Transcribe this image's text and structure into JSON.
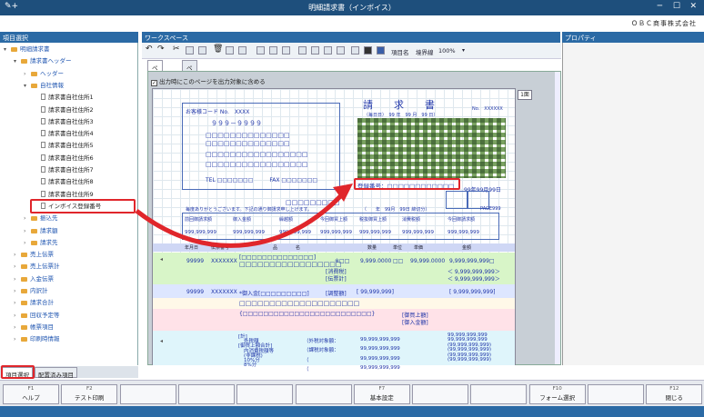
{
  "window": {
    "title": "明細請求書（インボイス）",
    "app_icon": "✎+",
    "minimize": "─",
    "maximize": "☐",
    "close": "✕"
  },
  "company": "ＯＢＣ商事株式会社",
  "panels": {
    "items": "項目選択",
    "workspace": "ワークスペース",
    "properties": "プロパティ"
  },
  "tree": [
    {
      "label": "明細請求書",
      "level": 0,
      "exp": "▾",
      "icon": "folder",
      "blue": true
    },
    {
      "label": "請求書ヘッダー",
      "level": 1,
      "exp": "▾",
      "icon": "folder",
      "blue": true
    },
    {
      "label": "ヘッダー",
      "level": 2,
      "exp": "›",
      "icon": "folder",
      "blue": true
    },
    {
      "label": "自社情報",
      "level": 2,
      "exp": "▾",
      "icon": "folder",
      "blue": true
    },
    {
      "label": "請求書自社住所1",
      "level": 3,
      "exp": "",
      "icon": "doc",
      "blue": false
    },
    {
      "label": "請求書自社住所2",
      "level": 3,
      "exp": "",
      "icon": "doc",
      "blue": false
    },
    {
      "label": "請求書自社住所3",
      "level": 3,
      "exp": "",
      "icon": "doc",
      "blue": false
    },
    {
      "label": "請求書自社住所4",
      "level": 3,
      "exp": "",
      "icon": "doc",
      "blue": false
    },
    {
      "label": "請求書自社住所5",
      "level": 3,
      "exp": "",
      "icon": "doc",
      "blue": false
    },
    {
      "label": "請求書自社住所6",
      "level": 3,
      "exp": "",
      "icon": "doc",
      "blue": false
    },
    {
      "label": "請求書自社住所7",
      "level": 3,
      "exp": "",
      "icon": "doc",
      "blue": false
    },
    {
      "label": "請求書自社住所8",
      "level": 3,
      "exp": "",
      "icon": "doc",
      "blue": false
    },
    {
      "label": "請求書自社住所9",
      "level": 3,
      "exp": "",
      "icon": "doc",
      "blue": false
    },
    {
      "label": "インボイス登録番号",
      "level": 3,
      "exp": "",
      "icon": "doc",
      "blue": false
    },
    {
      "label": "振込先",
      "level": 2,
      "exp": "›",
      "icon": "folder",
      "blue": true
    },
    {
      "label": "請求額",
      "level": 2,
      "exp": "›",
      "icon": "folder",
      "blue": true
    },
    {
      "label": "請求先",
      "level": 2,
      "exp": "›",
      "icon": "folder",
      "blue": true
    },
    {
      "label": "売上伝票",
      "level": 1,
      "exp": "›",
      "icon": "folder",
      "blue": true
    },
    {
      "label": "売上伝票計",
      "level": 1,
      "exp": "›",
      "icon": "folder",
      "blue": true
    },
    {
      "label": "入金伝票",
      "level": 1,
      "exp": "›",
      "icon": "folder",
      "blue": true
    },
    {
      "label": "内訳計",
      "level": 1,
      "exp": "›",
      "icon": "folder",
      "blue": true
    },
    {
      "label": "請求合計",
      "level": 1,
      "exp": "›",
      "icon": "folder",
      "blue": true
    },
    {
      "label": "回収予定等",
      "level": 1,
      "exp": "›",
      "icon": "folder",
      "blue": true
    },
    {
      "label": "帳票項目",
      "level": 1,
      "exp": "›",
      "icon": "folder",
      "blue": true
    },
    {
      "label": "印刷時情報",
      "level": 1,
      "exp": "›",
      "icon": "folder",
      "blue": true
    }
  ],
  "bottom_tabs": [
    "項目選択",
    "配置済み項目"
  ],
  "toolbar": {
    "item_name": "項目名",
    "border": "境界線",
    "zoom": "100%",
    "zoom_arrow": "▾"
  },
  "page_tabs": [
    "ページ1",
    "ページ2"
  ],
  "checkbox": {
    "checked": true,
    "mark": "✓",
    "label": "出力時にこのページを出力対象に含める"
  },
  "one_button": "1面",
  "invoice": {
    "title": "請　求　書",
    "customer_code": "お客様コード No.　XXXX",
    "nines": "９９９－９９９９",
    "squares12": "□□□□□□□□□□□□□□",
    "squares8": "□□□□□□□□□□□□",
    "squares7": "□□□□□□□□□",
    "squares_name": "□□□□□□□□□□□□□□□□□",
    "tel": "TEL □□□□□□□　　　FAX □□□□□□□",
    "date_top": "（毎日日）　99 年　99 月　99 日）",
    "no": "No.　XXXXXX",
    "registration": "登録番号：□□□□□□□□□□□□",
    "ymd": "99年99月99日",
    "greeting": "毎度ありがとうございます。下記の通り御請求申し上げます。",
    "period": "（　　年　99月　99日 締切分）",
    "pageno": "PAGE999",
    "headers": [
      "前回御請求額",
      "御入金額",
      "繰越額",
      "今回御買上額",
      "税抜御買上額",
      "消費税額",
      "今回御請求額"
    ],
    "amounts": [
      "999,999,999",
      "999,999,999",
      "999,999,999",
      "999,999,999",
      "999,999,999",
      "999,999,999",
      "999,999,999"
    ],
    "detail_headers": [
      "年月日",
      "伝票番号",
      "品　　　　名",
      "数量",
      "単位",
      "単価",
      "金額"
    ],
    "row1": {
      "code": "99999",
      "slip": "XXXXXXX",
      "name": "[□□□□□□□□□□□□□□]",
      "mark": "※□□",
      "qty": "9,999.0000",
      "unit": "□□",
      "price": "99,999.0000",
      "amount": "9,999,999,999□"
    },
    "tax_label": "[消費税]",
    "tax_amt": "＜ 9,999,999,999＞",
    "slip_total": "[伝票計]",
    "slip_total_amt": "＜ 9,999,999,999＞",
    "row2": {
      "code": "99999",
      "slip": "XXXXXXX",
      "name": "*御入金[□□□□□□□□□]",
      "adj": "[調整額]",
      "adj_amt": "[ 99,999,999]",
      "amount": "[ 9,999,999,999]"
    },
    "row3_name": "□□□□□□□□□□□□□□□□□□□□",
    "row3b": "□□□□□□□□□□□□□□□□□",
    "row4_name": "{□□□□□□□□□□□□□□□□□□□□□□□□□}",
    "buy_label": "[御買上額]",
    "pay_label": "[御入金額]",
    "bottom_labels": [
      "[計]",
      "外税額",
      "[御買上額合計]",
      "内消費税額等",
      "(非課税)",
      "10%分",
      "8%分"
    ],
    "bottom_mid": [
      "（外税対象額：",
      "（課税対象額：",
      "（",
      "（"
    ],
    "bottom_vals": [
      "99,999,999,999",
      "99,999,999,999",
      "99,999,999,999",
      "99,999,999,999"
    ],
    "bottom_amts": [
      "99,999,999,999",
      "99,999,999,999",
      "(99,999,999,999)",
      "(99,999,999,999)",
      "(99,999,999,999)",
      "(99,999,999,999)"
    ]
  },
  "fkeys": [
    {
      "key": "F1",
      "label": "ヘルプ"
    },
    {
      "key": "F2",
      "label": "テスト印刷"
    },
    {
      "key": "",
      "label": ""
    },
    {
      "key": "",
      "label": ""
    },
    {
      "key": "",
      "label": ""
    },
    {
      "key": "",
      "label": ""
    },
    {
      "key": "F7",
      "label": "基本設定"
    },
    {
      "key": "",
      "label": ""
    },
    {
      "key": "",
      "label": ""
    },
    {
      "key": "F10",
      "label": "フォーム選択"
    },
    {
      "key": "",
      "label": ""
    },
    {
      "key": "F12",
      "label": "閉じる"
    }
  ],
  "colors": {
    "title_bar": "#1e4f7c",
    "panel_header": "#2b6aa5",
    "highlight": "#e0262b",
    "invoice_blue": "#1f35a8",
    "band_green": "#d8f5c8",
    "band_blue": "#dde6ff",
    "band_pink": "#ffe2e8",
    "band_cyan": "#dff5fb"
  }
}
